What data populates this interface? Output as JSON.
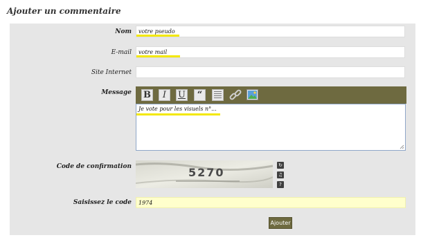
{
  "page_title": "Ajouter un commentaire",
  "form": {
    "name": {
      "label": "Nom",
      "value": "votre pseudo"
    },
    "email": {
      "label": "E-mail",
      "value": "votre mail"
    },
    "website": {
      "label": "Site Internet",
      "value": ""
    },
    "message": {
      "label": "Message",
      "value": "Je vote pour les visuels n°...",
      "toolbar": [
        {
          "label": "B",
          "icon": "bold-icon"
        },
        {
          "label": "I",
          "icon": "italic-icon"
        },
        {
          "label": "U",
          "icon": "underline-icon"
        },
        {
          "label": "“",
          "icon": "quote-icon"
        },
        {
          "label": "",
          "icon": "align-icon"
        },
        {
          "label": "",
          "icon": "link-icon"
        },
        {
          "label": "",
          "icon": "image-icon"
        }
      ]
    },
    "captcha": {
      "label": "Code de confirmation",
      "image_text": "5270",
      "controls": [
        {
          "label": "↻",
          "icon": "refresh-icon"
        },
        {
          "label": "♫",
          "icon": "audio-icon"
        },
        {
          "label": "?",
          "icon": "help-icon"
        }
      ]
    },
    "code": {
      "label": "Saisissez le code",
      "value": "1974"
    },
    "submit_label": "Ajouter"
  },
  "colors": {
    "toolbar": "#6e6a40",
    "panel": "#e6e6e6",
    "highlight": "#f3e800",
    "code_field": "#ffffcc"
  }
}
